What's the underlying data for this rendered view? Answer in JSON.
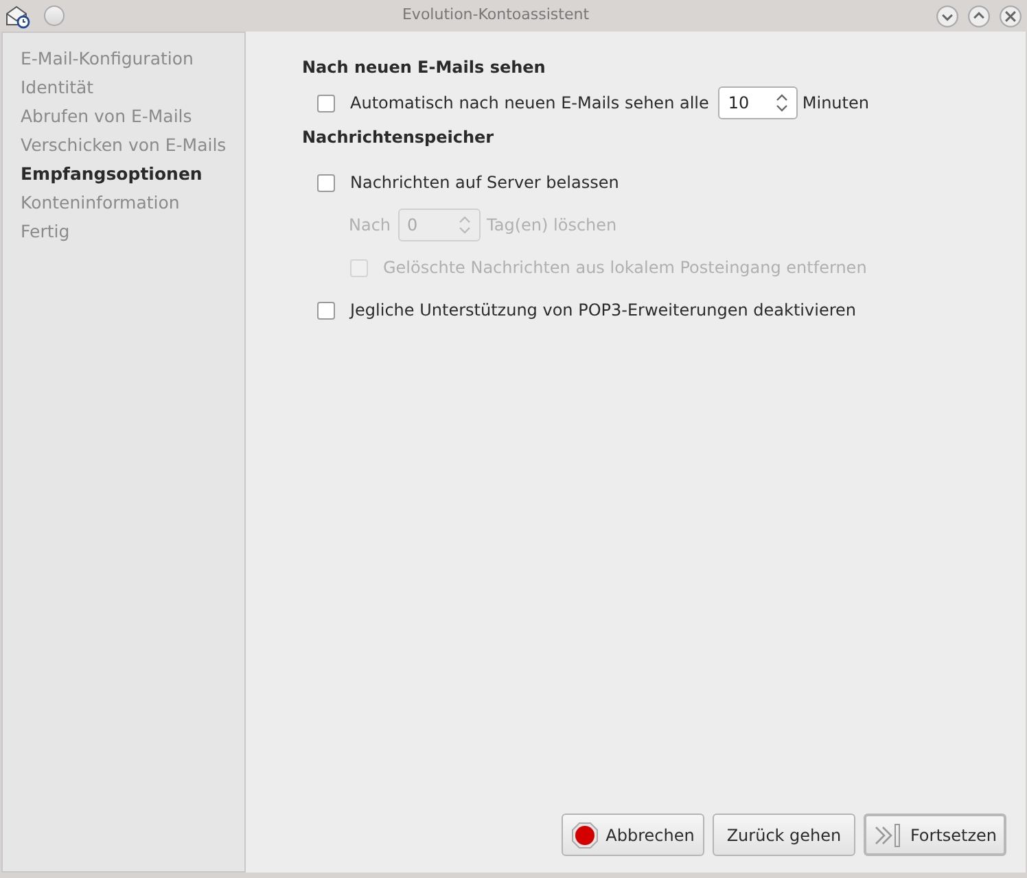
{
  "window": {
    "title": "Evolution-Kontoassistent"
  },
  "sidebar": {
    "items": [
      {
        "label": "E-Mail-Konfiguration",
        "selected": false
      },
      {
        "label": "Identität",
        "selected": false
      },
      {
        "label": "Abrufen von E-Mails",
        "selected": false
      },
      {
        "label": "Verschicken von E-Mails",
        "selected": false
      },
      {
        "label": "Empfangsoptionen",
        "selected": true
      },
      {
        "label": "Konteninformation",
        "selected": false
      },
      {
        "label": "Fertig",
        "selected": false
      }
    ]
  },
  "sections": [
    {
      "heading": "Nach neuen E-Mails sehen",
      "rows": [
        {
          "kind": "checkbox",
          "label": "Automatisch nach neuen E-Mails sehen alle",
          "checked": false,
          "disabled": false,
          "spin": {
            "value": "10",
            "suffix": "Minuten",
            "disabled": false
          }
        }
      ]
    },
    {
      "heading": "Nachrichtenspeicher",
      "rows": [
        {
          "kind": "checkbox",
          "label": "Nachrichten auf Server belassen",
          "checked": false,
          "disabled": false,
          "children": [
            {
              "kind": "spin",
              "prefix": "Nach",
              "value": "0",
              "suffix": "Tag(en) löschen",
              "disabled": true
            },
            {
              "kind": "checkbox",
              "label": "Gelöschte Nachrichten aus lokalem Posteingang entfernen",
              "checked": false,
              "disabled": true
            }
          ]
        },
        {
          "kind": "checkbox",
          "label": "Jegliche Unterstützung von POP3-Erweiterungen deaktivieren",
          "checked": false,
          "disabled": false
        }
      ]
    }
  ],
  "buttons": [
    {
      "label": "Abbrechen",
      "kind": "cancel",
      "default": false
    },
    {
      "label": "Zurück gehen",
      "kind": "back",
      "default": false
    },
    {
      "label": "Fortsetzen",
      "kind": "forward",
      "default": true
    }
  ]
}
